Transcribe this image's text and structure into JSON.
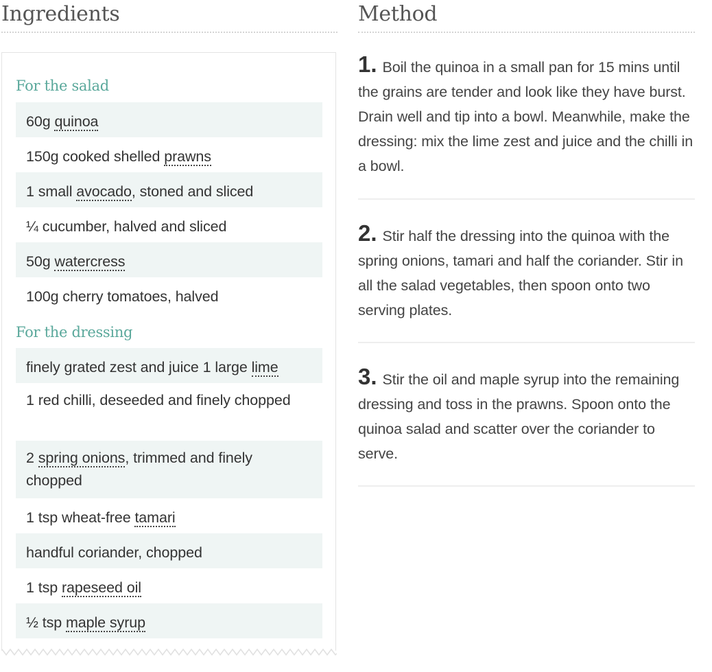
{
  "ingredients": {
    "heading": "Ingredients",
    "salad": {
      "title": "For the salad",
      "items": [
        {
          "pre": "60g ",
          "link": "quinoa",
          "post": ""
        },
        {
          "pre": "150g cooked shelled ",
          "link": "prawns",
          "post": ""
        },
        {
          "pre": "1 small ",
          "link": "avocado",
          "post": ", stoned and sliced"
        },
        {
          "pre": "¼ cucumber, halved and sliced",
          "link": "",
          "post": ""
        },
        {
          "pre": "50g ",
          "link": "watercress",
          "post": ""
        },
        {
          "pre": "100g cherry tomatoes, halved",
          "link": "",
          "post": ""
        }
      ]
    },
    "dressing": {
      "title": "For the dressing",
      "items": [
        {
          "pre": "finely grated zest and juice 1 large ",
          "link": "lime",
          "post": ""
        },
        {
          "pre": "1 red chilli, deseeded and finely chopped",
          "link": "",
          "post": ""
        },
        {
          "pre": "2 ",
          "link": "spring onions",
          "post": ", trimmed and finely chopped"
        },
        {
          "pre": "1 tsp wheat-free ",
          "link": "tamari",
          "post": ""
        },
        {
          "pre": "handful coriander, chopped",
          "link": "",
          "post": ""
        },
        {
          "pre": "1 tsp ",
          "link": "rapeseed oil",
          "post": ""
        },
        {
          "pre": "½ tsp ",
          "link": "maple syrup",
          "post": ""
        }
      ]
    }
  },
  "method": {
    "heading": "Method",
    "steps": [
      {
        "num": "1.",
        "text": "Boil the quinoa in a small pan for 15 mins until the grains are tender and look like they have burst. Drain well and tip into a bowl. Meanwhile, make the dressing: mix the lime zest and juice and the chilli in a bowl."
      },
      {
        "num": "2.",
        "text": "Stir half the dressing into the quinoa with the spring onions, tamari and half the coriander. Stir in all the salad vegetables, then spoon onto two serving plates."
      },
      {
        "num": "3.",
        "text": "Stir the oil and maple syrup into the remaining dressing and toss in the prawns. Spoon onto the quinoa salad and scatter over the coriander to serve."
      }
    ]
  },
  "colors": {
    "accent": "#5aa89b",
    "row_shade": "#eff5f4",
    "rule": "#eeeeee"
  }
}
